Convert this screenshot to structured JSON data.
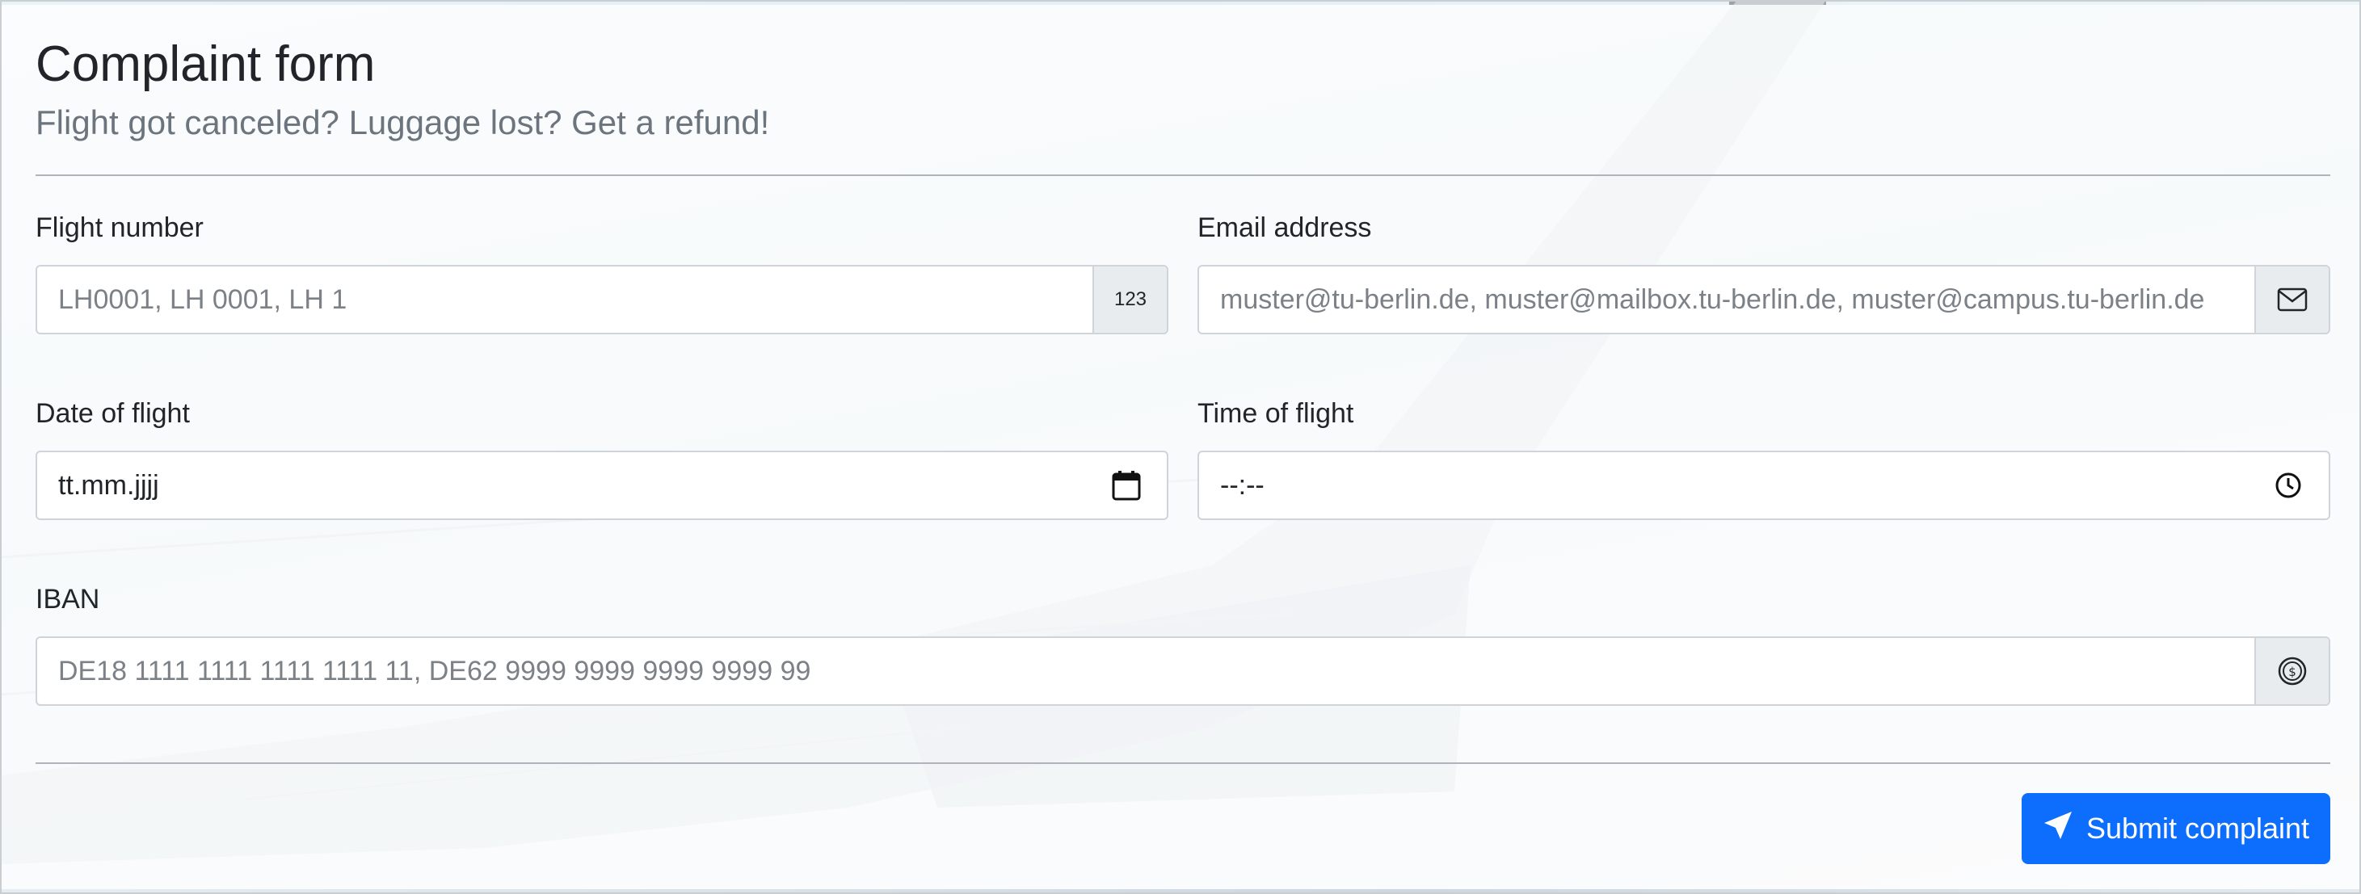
{
  "form": {
    "title": "Complaint form",
    "subtitle": "Flight got canceled? Luggage lost? Get a refund!"
  },
  "fields": {
    "flight_number": {
      "label": "Flight number",
      "placeholder": "LH0001, LH 0001, LH 1",
      "addon": "123"
    },
    "email": {
      "label": "Email address",
      "placeholder": "muster@tu-berlin.de, muster@mailbox.tu-berlin.de, muster@campus.tu-berlin.de",
      "icon": "envelope-icon"
    },
    "date": {
      "label": "Date of flight",
      "value": "tt.mm.jjjj",
      "icon": "calendar-icon"
    },
    "time": {
      "label": "Time of flight",
      "value": "--:--",
      "icon": "clock-icon"
    },
    "iban": {
      "label": "IBAN",
      "placeholder": "DE18 1111 1111 1111 1111 11, DE62 9999 9999 9999 9999 99",
      "icon": "coin-icon"
    }
  },
  "submit": {
    "label": "Submit complaint",
    "icon": "send-icon"
  },
  "colors": {
    "primary": "#0d6efd",
    "muted_text": "#6c757d",
    "addon_bg": "#e9ecef",
    "border": "#ced4da"
  }
}
